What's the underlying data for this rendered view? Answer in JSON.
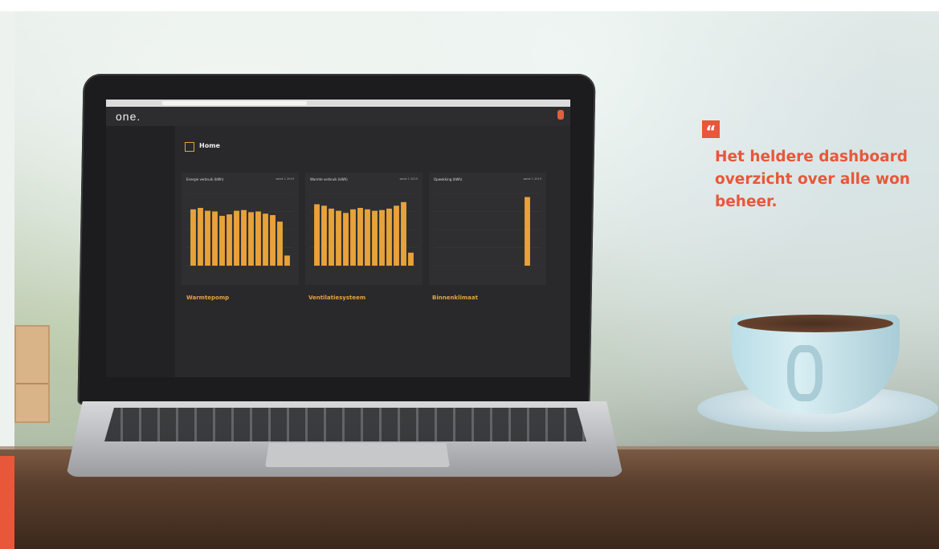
{
  "quote": {
    "mark": "“",
    "line1": "Het heldere dashboard",
    "line2": "overzicht over alle won",
    "line3": "beheer."
  },
  "dashboard": {
    "logo": "one.",
    "page_title": "Home",
    "panels": [
      {
        "title": "Energie verbruik (kWh)",
        "week": "week 1 2019",
        "values": [
          78,
          80,
          76,
          75,
          69,
          71,
          76,
          77,
          74,
          75,
          72,
          70,
          61,
          14
        ]
      },
      {
        "title": "Warmte verbruik (kWh)",
        "week": "week 1 2019",
        "values": [
          85,
          83,
          79,
          76,
          73,
          78,
          80,
          78,
          76,
          77,
          79,
          83,
          88,
          18
        ]
      },
      {
        "title": "Opwekking (kWh)",
        "week": "week 1 2019",
        "values": [
          0,
          0,
          0,
          0,
          0,
          0,
          0,
          0,
          0,
          0,
          0,
          0,
          95,
          0
        ]
      }
    ],
    "sections": [
      {
        "title": "Warmtepomp"
      },
      {
        "title": "Ventilatiesysteem"
      },
      {
        "title": "Binnenklimaat"
      }
    ]
  },
  "colors": {
    "accent": "#e8573a",
    "chart_bar": "#e8a23a"
  }
}
